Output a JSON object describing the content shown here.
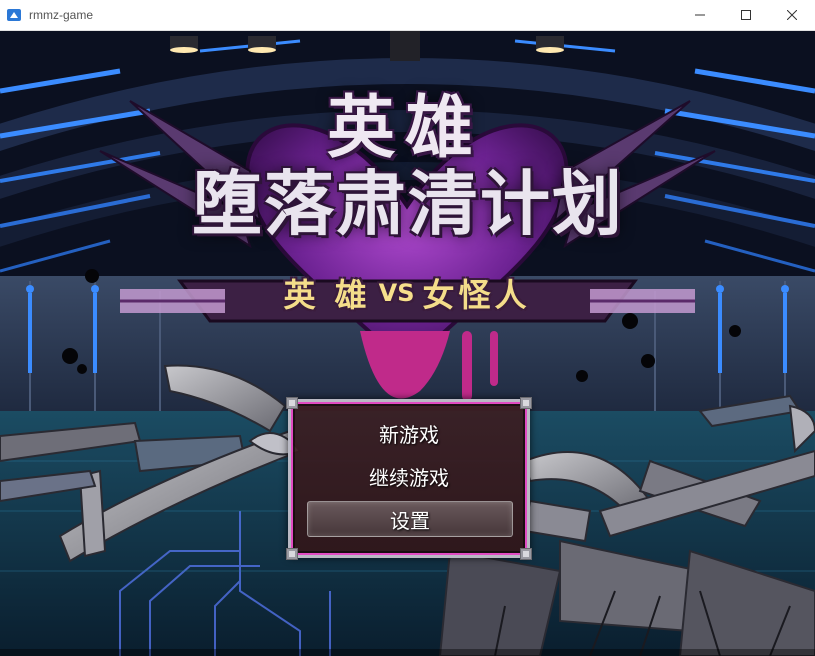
{
  "window": {
    "title": "rmmz-game",
    "icon": "rpg-maker-icon",
    "controls": [
      "minimize-icon",
      "maximize-icon",
      "close-icon"
    ]
  },
  "logo": {
    "line1": "英雄",
    "line2": "堕落肃清计划",
    "sub_left": "英 雄",
    "sub_vs": "VS",
    "sub_right": "女怪人"
  },
  "menu": {
    "items": [
      {
        "label": "新游戏",
        "selected": false
      },
      {
        "label": "继续游戏",
        "selected": false
      },
      {
        "label": "设置",
        "selected": true
      }
    ]
  },
  "colors": {
    "menu_border_accent": "#e04bc2",
    "logo_heart": "#7a2a9a",
    "neon_blue": "#3b8cff",
    "subtitle_gold": "#f4dd8a"
  }
}
